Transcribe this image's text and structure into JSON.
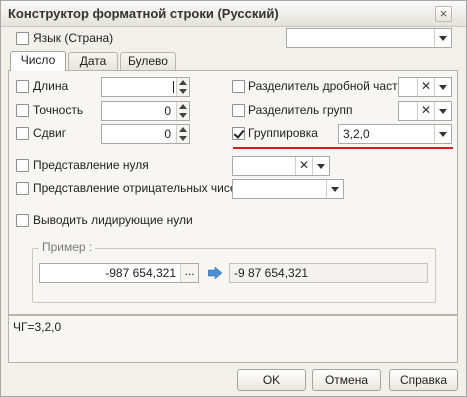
{
  "window": {
    "title": "Конструктор форматной строки (Русский)"
  },
  "top": {
    "language_label": "Язык (Страна)",
    "language_value": ""
  },
  "tabs": [
    {
      "label": "Число",
      "active": true
    },
    {
      "label": "Дата",
      "active": false
    },
    {
      "label": "Булево",
      "active": false
    }
  ],
  "number_tab": {
    "length_label": "Длина",
    "length_value": "",
    "precision_label": "Точность",
    "precision_value": "0",
    "shift_label": "Сдвиг",
    "shift_value": "0",
    "decimal_sep_label": "Разделитель дробной части",
    "group_sep_label": "Разделитель групп",
    "grouping_label": "Группировка",
    "grouping_value": "3,2,0",
    "zero_repr_label": "Представление нуля",
    "negative_repr_label": "Представление отрицательных чисел",
    "leading_zeros_label": "Выводить лидирующие нули"
  },
  "example": {
    "legend": "Пример :",
    "input_value": "-987 654,321",
    "result_value": "-9 87 654,321",
    "dots_label": "..."
  },
  "format_string": "ЧГ=3,2,0",
  "buttons": {
    "ok": "OK",
    "cancel": "Отмена",
    "help": "Справка"
  },
  "colors": {
    "accent_underline": "#d81b1b",
    "arrow": "#4a8fd6"
  }
}
